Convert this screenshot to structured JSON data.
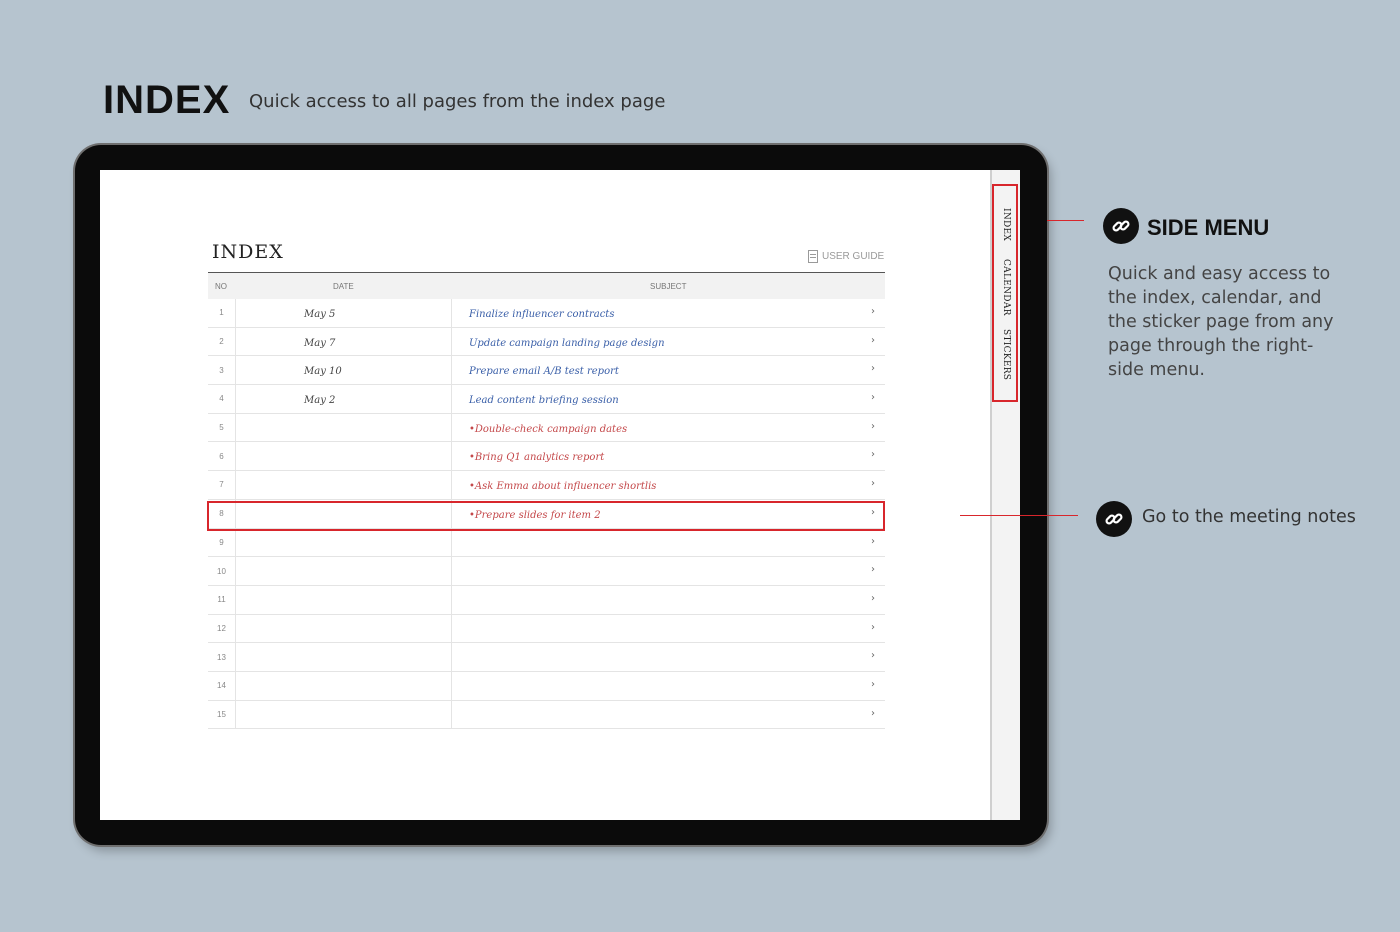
{
  "header": {
    "title": "INDEX",
    "subtitle": "Quick access to all pages from the index page"
  },
  "page": {
    "title": "INDEX",
    "user_guide": "USER GUIDE",
    "columns": {
      "no": "NO",
      "date": "DATE",
      "subject": "SUBJECT"
    }
  },
  "rows": [
    {
      "no": "1",
      "date": "May 5",
      "subject": "Finalize influencer contracts",
      "color": "#3a5fa8"
    },
    {
      "no": "2",
      "date": "May 7",
      "subject": "Update campaign landing page design",
      "color": "#3a5fa8"
    },
    {
      "no": "3",
      "date": "May 10",
      "subject": "Prepare email A/B test report",
      "color": "#3a5fa8"
    },
    {
      "no": "4",
      "date": "May 2",
      "subject": "Lead content briefing session",
      "color": "#3a5fa8"
    },
    {
      "no": "5",
      "date": "",
      "subject": "•Double-check campaign dates",
      "color": "#c4484a"
    },
    {
      "no": "6",
      "date": "",
      "subject": "•Bring Q1 analytics report",
      "color": "#c4484a"
    },
    {
      "no": "7",
      "date": "",
      "subject": "•Ask Emma about influencer shortlis",
      "color": "#c4484a"
    },
    {
      "no": "8",
      "date": "",
      "subject": "•Prepare slides for item 2",
      "color": "#c4484a"
    },
    {
      "no": "9",
      "date": "",
      "subject": "",
      "color": "#333333"
    },
    {
      "no": "10",
      "date": "",
      "subject": "",
      "color": "#333333"
    },
    {
      "no": "11",
      "date": "",
      "subject": "",
      "color": "#333333"
    },
    {
      "no": "12",
      "date": "",
      "subject": "",
      "color": "#333333"
    },
    {
      "no": "13",
      "date": "",
      "subject": "",
      "color": "#333333"
    },
    {
      "no": "14",
      "date": "",
      "subject": "",
      "color": "#333333"
    },
    {
      "no": "15",
      "date": "",
      "subject": "",
      "color": "#333333"
    }
  ],
  "chevron": "›",
  "sidebar": {
    "tabs": [
      "INDEX",
      "CALENDAR",
      "STICKERS"
    ]
  },
  "callouts": {
    "side_menu_title": "SIDE MENU",
    "side_menu_desc": "Quick and easy access to the index, calendar, and the sticker page from any page through the right-side menu.",
    "meeting_notes": "Go to the meeting notes"
  },
  "colors": {
    "highlight": "#d8262c",
    "handwriting_blue": "#3a5fa8",
    "handwriting_red": "#c4484a",
    "background": "#b6c4cf"
  },
  "icons": {
    "callout": "link-icon",
    "guide": "document-icon",
    "row_link": "chevron-right-icon"
  }
}
